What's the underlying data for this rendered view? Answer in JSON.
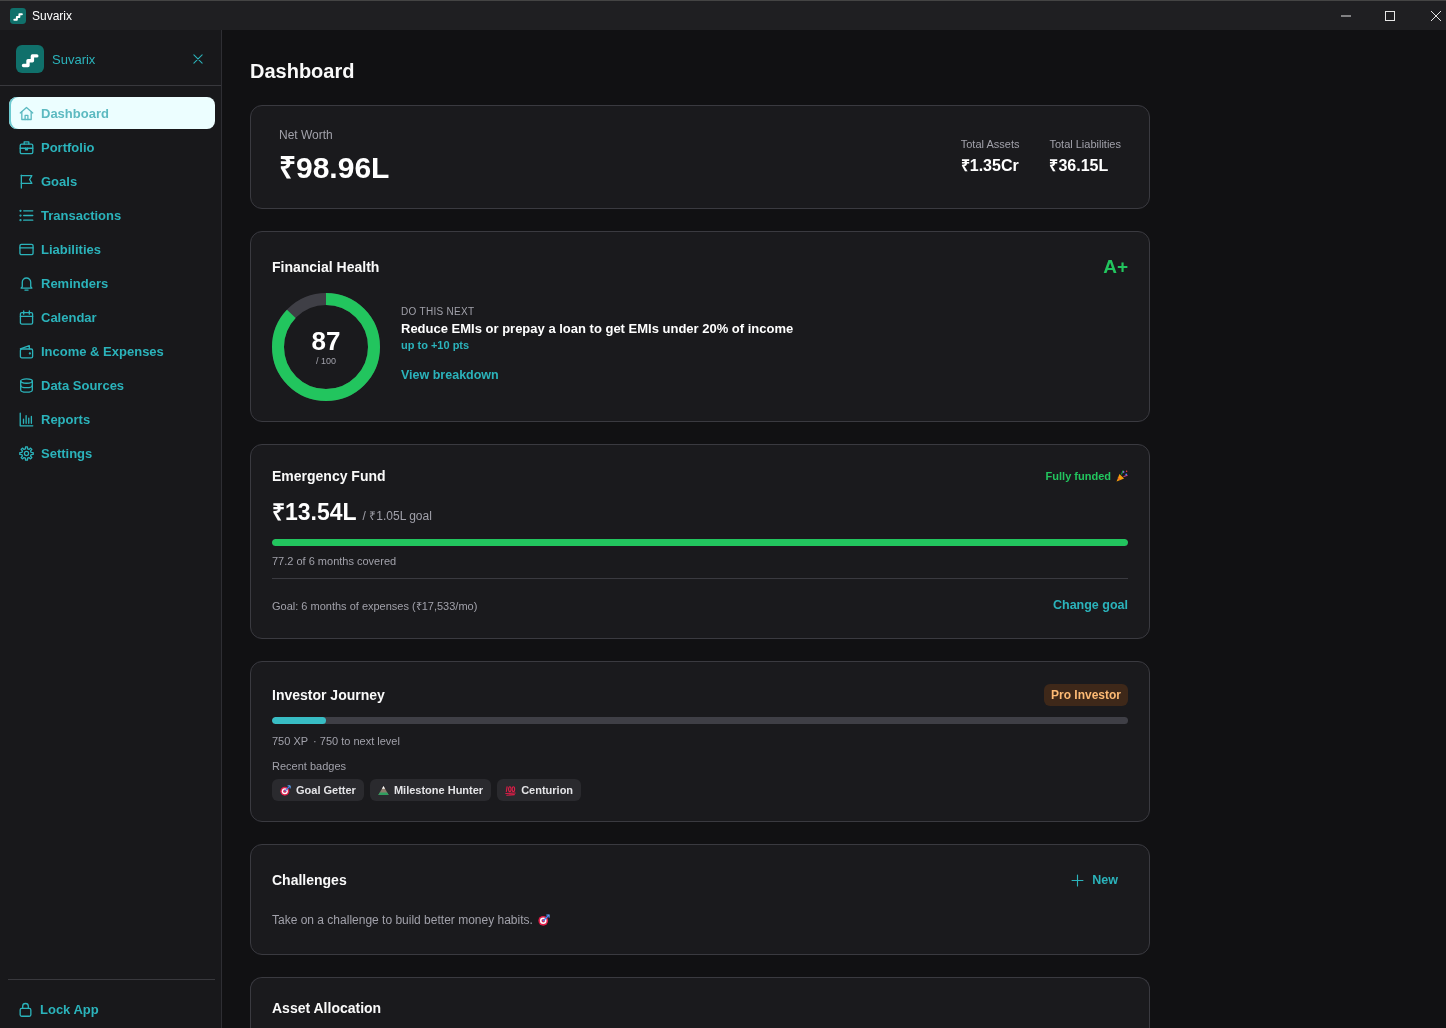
{
  "window": {
    "title": "Suvarix"
  },
  "sidebar": {
    "brand": "Suvarix",
    "items": [
      {
        "label": "Dashboard",
        "selected": true
      },
      {
        "label": "Portfolio",
        "selected": false
      },
      {
        "label": "Goals",
        "selected": false
      },
      {
        "label": "Transactions",
        "selected": false
      },
      {
        "label": "Liabilities",
        "selected": false
      },
      {
        "label": "Reminders",
        "selected": false
      },
      {
        "label": "Calendar",
        "selected": false
      },
      {
        "label": "Income & Expenses",
        "selected": false
      },
      {
        "label": "Data Sources",
        "selected": false
      },
      {
        "label": "Reports",
        "selected": false
      },
      {
        "label": "Settings",
        "selected": false
      }
    ],
    "footer_item": "Lock App"
  },
  "page": {
    "title": "Dashboard"
  },
  "net_worth": {
    "label": "Net Worth",
    "value": "₹98.96L",
    "stats": [
      {
        "label": "Total Assets",
        "value": "₹1.35Cr"
      },
      {
        "label": "Total Liabilities",
        "value": "₹36.15L"
      }
    ]
  },
  "financial_health": {
    "title": "Financial Health",
    "grade": "A+",
    "score": "87",
    "score_max": "/ 100",
    "level": 0.87,
    "eyebrow": "DO THIS NEXT",
    "action": "Reduce EMIs or prepay a loan to get EMIs under 20% of income",
    "gain": "up to +10 pts",
    "link": "View breakdown"
  },
  "emergency_fund": {
    "title": "Emergency Fund",
    "status": "Fully funded",
    "amount": "₹13.54L",
    "goal": "/ ₹1.05L goal",
    "level": 1,
    "coverage": "77.2 of 6 months covered",
    "goal_note": "Goal: 6 months of expenses (₹17,533/mo)",
    "action": "Change goal"
  },
  "investor_journey": {
    "title": "Investor Journey",
    "rank": "Pro Investor",
    "level": 0.063,
    "xp": "750 XP",
    "next": "· 750 to next level",
    "badges_label": "Recent badges",
    "badges": [
      {
        "label": "Goal Getter"
      },
      {
        "label": "Milestone Hunter"
      },
      {
        "label": "Centurion"
      }
    ]
  },
  "challenges": {
    "title": "Challenges",
    "action": "New",
    "empty_text": "Take on a challenge to build better money habits."
  },
  "asset_allocation": {
    "title": "Asset Allocation"
  }
}
